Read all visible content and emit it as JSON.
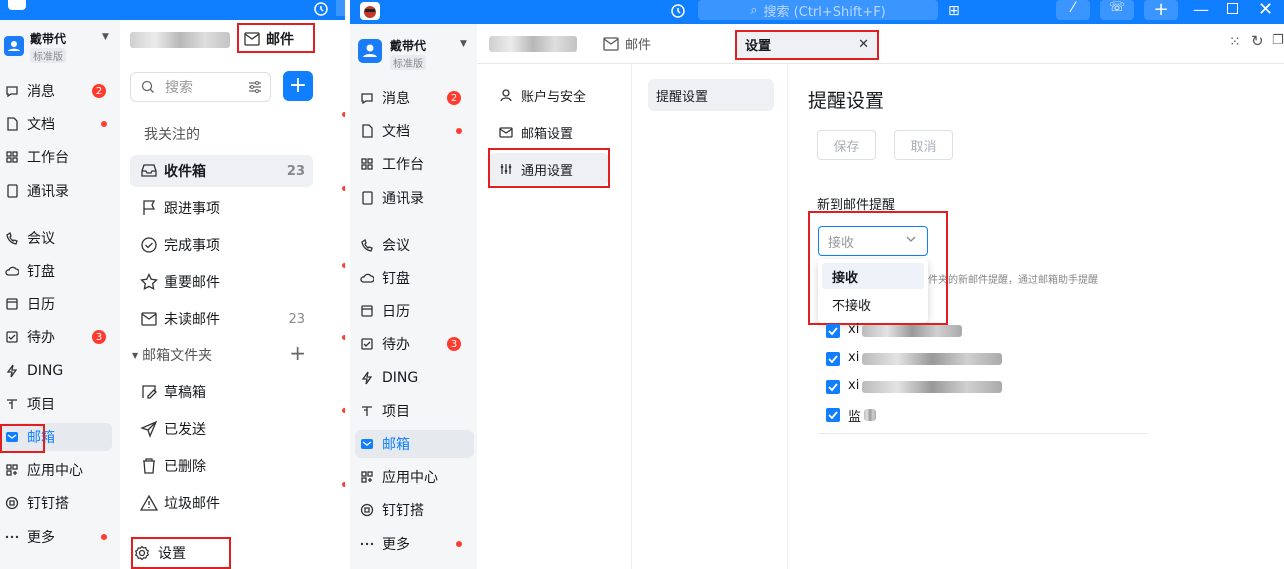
{
  "left": {
    "org": {
      "name": "戴带代",
      "plan": "标准版"
    },
    "nav": [
      {
        "label": "消息",
        "icon": "message-icon",
        "badge": "2"
      },
      {
        "label": "文档",
        "icon": "document-icon",
        "dot": true
      },
      {
        "label": "工作台",
        "icon": "workbench-icon"
      },
      {
        "label": "通讯录",
        "icon": "contacts-icon"
      },
      {
        "label": "会议",
        "icon": "meeting-icon"
      },
      {
        "label": "钉盘",
        "icon": "cloud-drive-icon"
      },
      {
        "label": "日历",
        "icon": "calendar-icon"
      },
      {
        "label": "待办",
        "icon": "todo-icon",
        "badge": "3"
      },
      {
        "label": "DING",
        "icon": "ding-icon"
      },
      {
        "label": "项目",
        "icon": "project-icon"
      },
      {
        "label": "邮箱",
        "icon": "mail-icon",
        "active": true
      },
      {
        "label": "应用中心",
        "icon": "app-center-icon"
      },
      {
        "label": "钉钉搭",
        "icon": "dingda-icon"
      },
      {
        "label": "更多",
        "icon": "more-icon",
        "dot": true
      }
    ],
    "mail_tab": "邮件",
    "search_placeholder": "搜索",
    "section_followed": "我关注的",
    "folders_followed": [
      {
        "label": "收件箱",
        "count": "23",
        "icon": "inbox-icon"
      },
      {
        "label": "跟进事项",
        "icon": "flag-icon"
      },
      {
        "label": "完成事项",
        "icon": "check-circle-icon"
      },
      {
        "label": "重要邮件",
        "icon": "star-icon"
      },
      {
        "label": "未读邮件",
        "count": "23",
        "icon": "unread-mail-icon"
      }
    ],
    "section_folders": "邮箱文件夹",
    "folders": [
      {
        "label": "草稿箱",
        "icon": "draft-icon"
      },
      {
        "label": "已发送",
        "icon": "sent-icon"
      },
      {
        "label": "已删除",
        "icon": "trash-icon"
      },
      {
        "label": "垃圾邮件",
        "icon": "spam-icon"
      }
    ],
    "settings_label": "设置"
  },
  "right": {
    "search_placeholder": "搜索 (Ctrl+Shift+F)",
    "org": {
      "name": "戴带代",
      "plan": "标准版"
    },
    "nav": [
      {
        "label": "消息",
        "icon": "message-icon",
        "badge": "2"
      },
      {
        "label": "文档",
        "icon": "document-icon",
        "dot": true
      },
      {
        "label": "工作台",
        "icon": "workbench-icon"
      },
      {
        "label": "通讯录",
        "icon": "contacts-icon"
      },
      {
        "label": "会议",
        "icon": "meeting-icon"
      },
      {
        "label": "钉盘",
        "icon": "cloud-drive-icon"
      },
      {
        "label": "日历",
        "icon": "calendar-icon"
      },
      {
        "label": "待办",
        "icon": "todo-icon",
        "badge": "3"
      },
      {
        "label": "DING",
        "icon": "ding-icon"
      },
      {
        "label": "项目",
        "icon": "project-icon"
      },
      {
        "label": "邮箱",
        "icon": "mail-icon",
        "active": true
      },
      {
        "label": "应用中心",
        "icon": "app-center-icon"
      },
      {
        "label": "钉钉搭",
        "icon": "dingda-icon"
      },
      {
        "label": "更多",
        "icon": "more-icon",
        "dot": true
      }
    ],
    "tabs": {
      "mail": "邮件",
      "settings": "设置"
    },
    "settings_menu": [
      {
        "label": "账户与安全",
        "icon": "user-icon"
      },
      {
        "label": "邮箱设置",
        "icon": "mailbox-settings-icon"
      },
      {
        "label": "通用设置",
        "icon": "sliders-icon",
        "active": true
      }
    ],
    "sub_menu": [
      "提醒设置"
    ],
    "content": {
      "title": "提醒设置",
      "save": "保存",
      "cancel": "取消",
      "field_label": "新到邮件提醒",
      "select_placeholder": "接收",
      "options": [
        "接收",
        "不接收"
      ],
      "hint": "件夹的新邮件提醒，通过邮箱助手提醒",
      "accounts": [
        {
          "prefix": "xi",
          "checked": true
        },
        {
          "prefix": "xi",
          "checked": true
        },
        {
          "prefix": "xi",
          "checked": true
        },
        {
          "prefix": "监",
          "checked": true
        }
      ]
    }
  }
}
